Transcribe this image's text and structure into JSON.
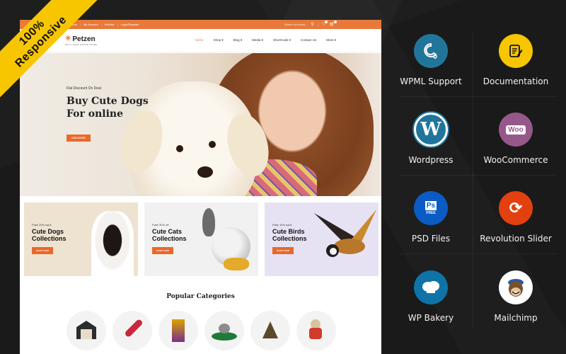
{
  "ribbon": {
    "line1": "100%",
    "line2": "Responsive"
  },
  "site": {
    "topbar": {
      "links": [
        "Checkout",
        "My Account",
        "Wishlist",
        "Login/Register"
      ],
      "search_placeholder": "Search products...",
      "wishlist_count": "0",
      "cart_count": "0"
    },
    "logo": {
      "name": "Petzen",
      "tagline": "PET'S SHOP ONLINE STORE"
    },
    "nav": [
      {
        "label": "Home",
        "active": true
      },
      {
        "label": "Shop ▾"
      },
      {
        "label": "Blog ▾"
      },
      {
        "label": "Media ▾"
      },
      {
        "label": "ShortCode ▾"
      },
      {
        "label": "Contact Us"
      },
      {
        "label": "More ▾"
      }
    ],
    "hero": {
      "subtitle": "Flat Discount On Deal",
      "title_line1": "Buy Cute Dogs",
      "title_line2": "For online",
      "button": "DISCOVER"
    },
    "promos": [
      {
        "subtitle": "Flate 20% save",
        "line1": "Cute Dogs",
        "line2": "Collections",
        "button": "SHOP NOW",
        "bg": "#eee3d0"
      },
      {
        "subtitle": "Flate 30% off",
        "line1": "Cute Cats",
        "line2": "Collections",
        "button": "SHOP NOW",
        "bg": "#f1f1f1"
      },
      {
        "subtitle": "Flate 15% save",
        "line1": "Cute Birds",
        "line2": "Collections",
        "button": "SHOP NOW",
        "bg": "#e7e2f3"
      }
    ],
    "popular": {
      "title": "Popular Categories",
      "items": [
        "pet-house",
        "chew-bone-toy",
        "cat-food-bag",
        "cat-bed",
        "hanging-toy",
        "dog-jacket"
      ]
    }
  },
  "features": [
    {
      "label": "WPML Support",
      "icon": "wpml-icon",
      "color": "#21759b"
    },
    {
      "label": "Documentation",
      "icon": "documentation-icon",
      "color": "#f7c600"
    },
    {
      "label": "Wordpress",
      "icon": "wordpress-icon",
      "color": "#21759b"
    },
    {
      "label": "WooCommerce",
      "icon": "woocommerce-icon",
      "color": "#96588a"
    },
    {
      "label": "PSD Files",
      "icon": "psd-icon",
      "color": "#0b5bc4",
      "icon_text": "Ps",
      "icon_sub": "FREE"
    },
    {
      "label": "Revolution Slider",
      "icon": "revolution-slider-icon",
      "color": "#e3400f"
    },
    {
      "label": "WP Bakery",
      "icon": "wpbakery-icon",
      "color": "#0f73a8"
    },
    {
      "label": "Mailchimp",
      "icon": "mailchimp-icon",
      "color": "#ffffff"
    }
  ],
  "colors": {
    "accent": "#e8793a",
    "button": "#e8682a",
    "ribbon": "#f7c600",
    "panel_bg": "#1a1a1a"
  }
}
